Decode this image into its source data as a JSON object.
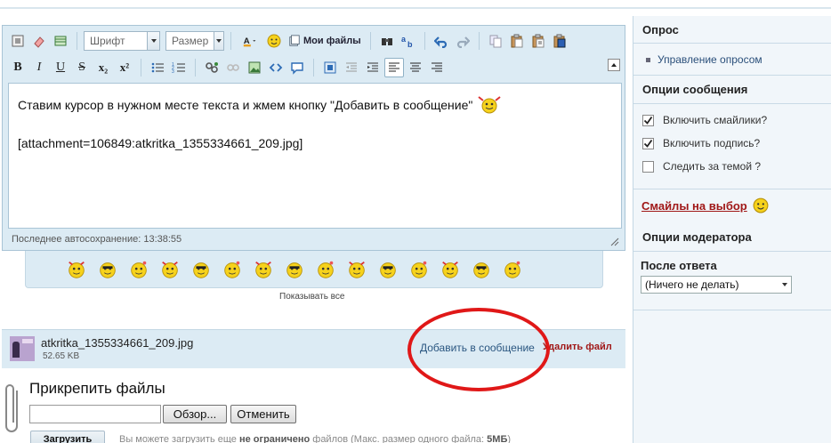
{
  "editor": {
    "font_placeholder": "Шрифт",
    "size_placeholder": "Размер",
    "my_files_label": "Мои файлы",
    "content_line1": "Ставим курсор в нужном месте текста и жмем кнопку \"Добавить в сообщение\"",
    "content_line2": "[attachment=106849:atkritka_1355334661_209.jpg]",
    "autosave_status": "Последнее автосохранение: 13:38:55",
    "bold_label": "B",
    "italic_label": "I",
    "underline_label": "U",
    "strike_label": "S",
    "subscript_label": "x₂",
    "superscript_label": "x²"
  },
  "smilies": {
    "show_all_label": "Показывать все",
    "count": 15
  },
  "attachment": {
    "file_name": "atkritka_1355334661_209.jpg",
    "file_size": "52.65 KB",
    "add_label": "Добавить в сообщение",
    "delete_label": "Удалить файл"
  },
  "upload": {
    "title": "Прикрепить файлы",
    "browse_label": "Обзор...",
    "cancel_label": "Отменить",
    "upload_label": "Загрузить",
    "note_prefix": "Вы можете загрузить еще",
    "note_unlimited": "не ограничено",
    "note_suffix": "файлов (Макс. размер одного файла:",
    "note_max_size": "5МБ",
    "note_end": ")"
  },
  "sidebar": {
    "poll_heading": "Опрос",
    "poll_manage_link": "Управление опросом",
    "message_options_heading": "Опции сообщения",
    "options": [
      {
        "label": "Включить смайлики?",
        "checked": true
      },
      {
        "label": "Включить подпись?",
        "checked": true
      },
      {
        "label": "Следить за темой ?",
        "checked": false
      }
    ],
    "smilies_link": "Смайлы на выбор",
    "moderator_heading": "Опции модератора",
    "after_reply_label": "После ответа",
    "after_reply_value": "(Ничего не делать)"
  },
  "colors": {
    "accent_blue": "#dcebf4",
    "link_blue": "#2a5680",
    "delete_red": "#a01818",
    "highlight_circle": "#e01818"
  }
}
